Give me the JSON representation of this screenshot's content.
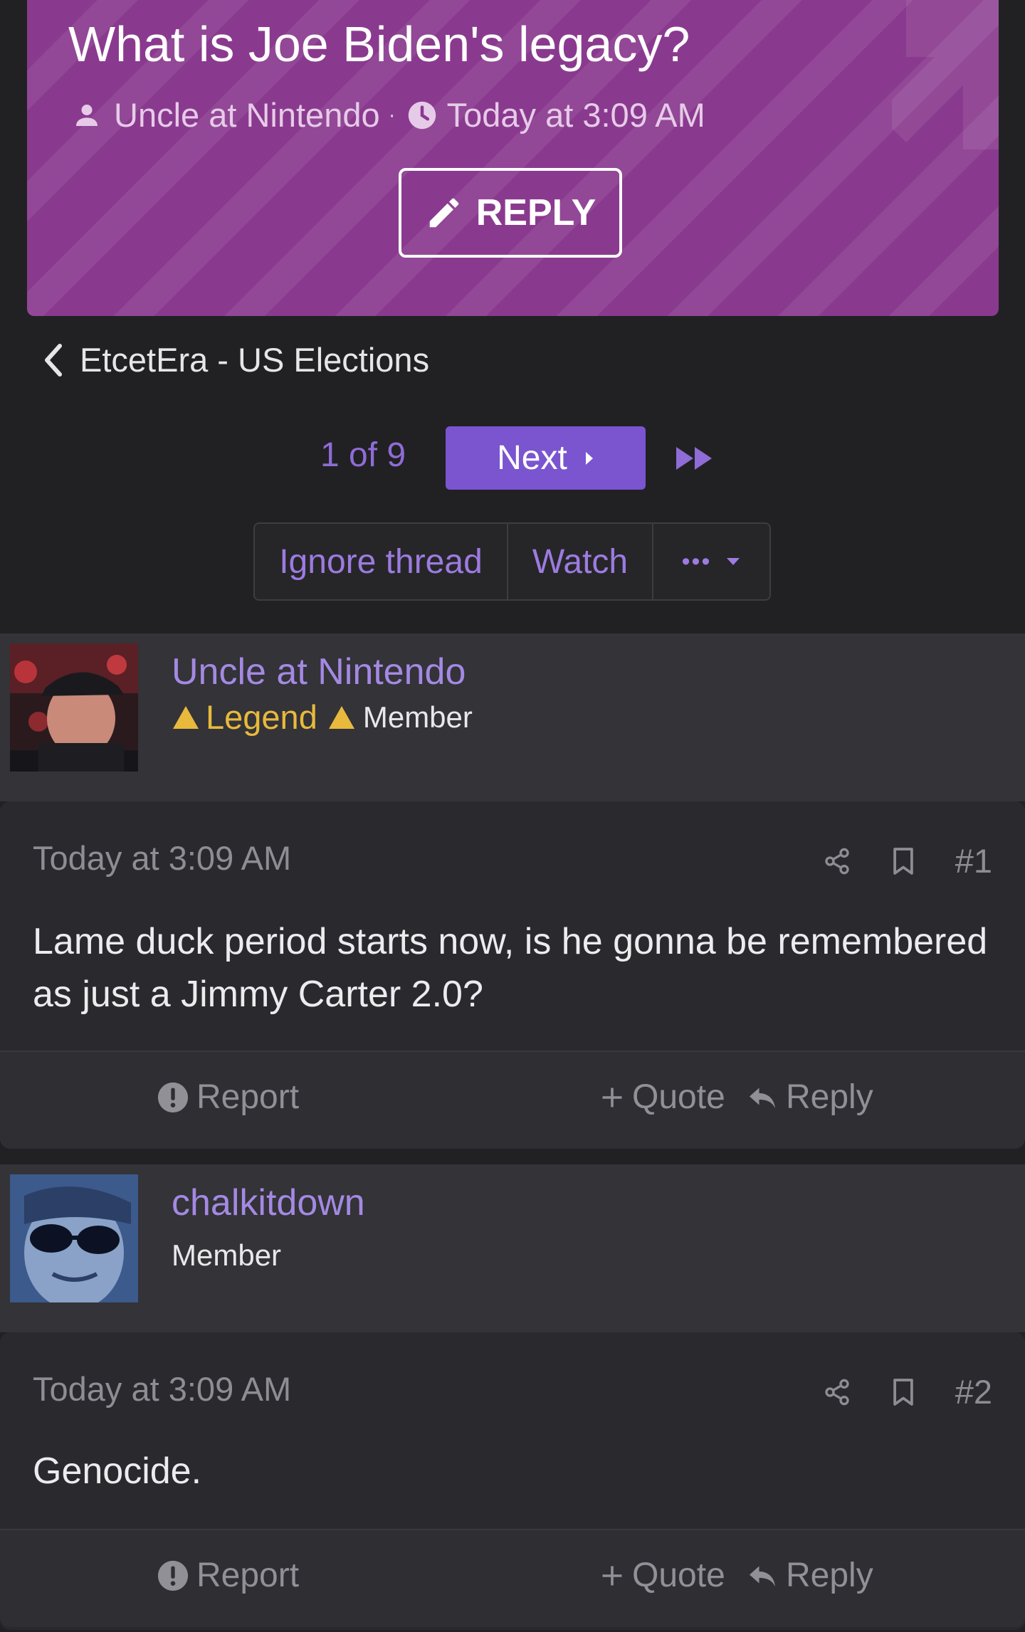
{
  "thread": {
    "title": "What is Joe Biden's legacy?",
    "author": "Uncle at Nintendo",
    "separator": "·",
    "time": "Today at 3:09 AM",
    "reply_label": "REPLY"
  },
  "breadcrumb": {
    "label": "EtcetEra - US Elections"
  },
  "pagination": {
    "current_text": "1 of 9",
    "next_label": "Next"
  },
  "actions": {
    "ignore_label": "Ignore thread",
    "watch_label": "Watch",
    "more_label": "•••"
  },
  "posts": [
    {
      "username": "Uncle at Nintendo",
      "badge": "Legend",
      "role": "Member",
      "time": "Today at 3:09 AM",
      "number": "#1",
      "body": "Lame duck period starts now, is he gonna be remembered as just a Jimmy Carter 2.0?",
      "report_label": "Report",
      "quote_label": "Quote",
      "reply_label": "Reply"
    },
    {
      "username": "chalkitdown",
      "role": "Member",
      "time": "Today at 3:09 AM",
      "number": "#2",
      "body": "Genocide.",
      "report_label": "Report",
      "quote_label": "Quote",
      "reply_label": "Reply"
    }
  ],
  "colors": {
    "banner": "#8a3a8e",
    "accent": "#7a55cf",
    "link": "#a489e3",
    "legend": "#e8b93c",
    "page_bg": "#212124"
  }
}
